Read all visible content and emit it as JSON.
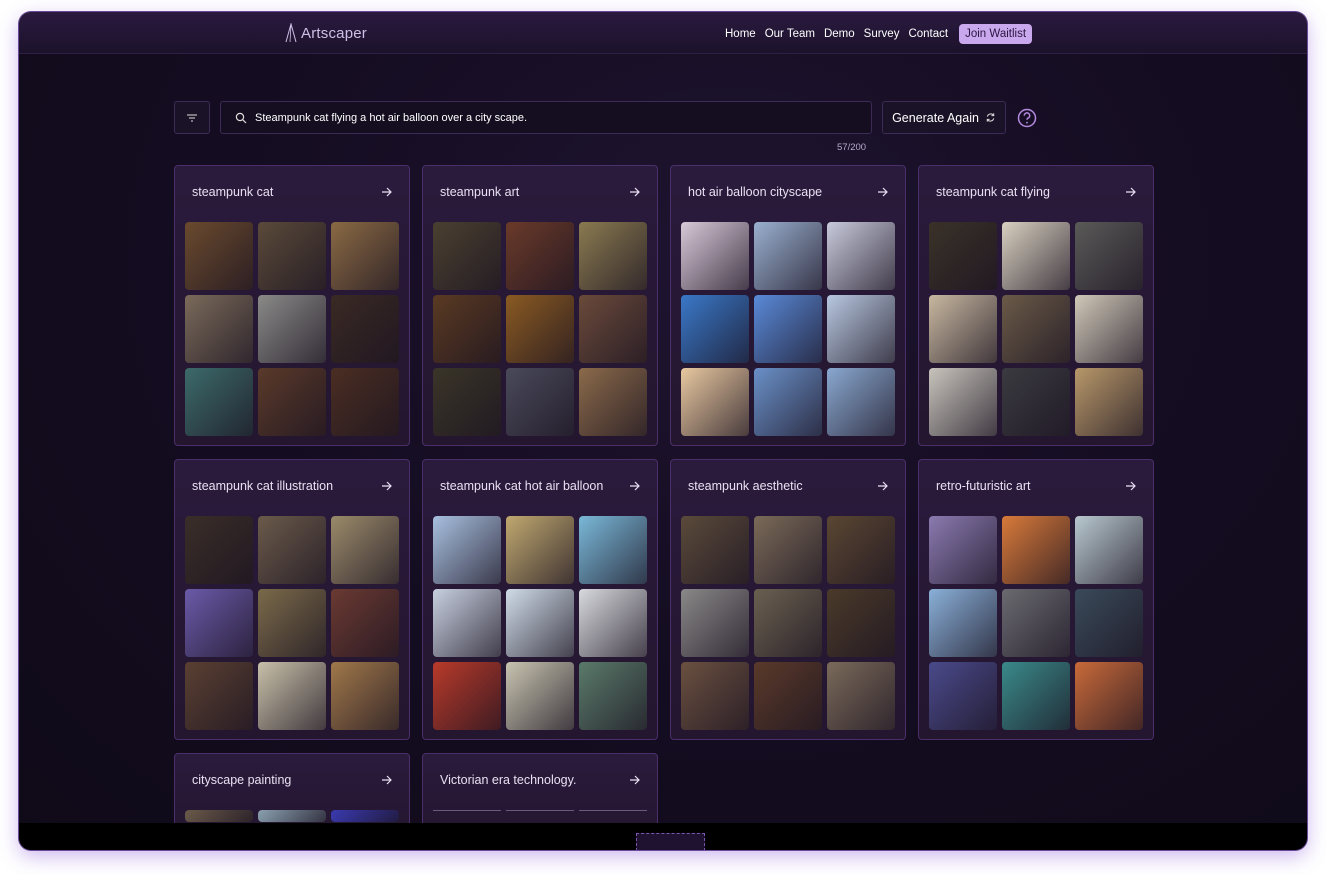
{
  "app": {
    "logo_text": "Artscaper",
    "nav": [
      "Home",
      "Our Team",
      "Demo",
      "Survey",
      "Contact"
    ],
    "cta": "Join Waitlist"
  },
  "search": {
    "query": "Steampunk cat flying a hot air balloon over a city scape.",
    "counter": "57/200",
    "generate_label": "Generate Again"
  },
  "colors": {
    "accent": "#c9a8ee",
    "background": "#150d22",
    "card": "#27182f",
    "card_border": "#4a2f6a"
  },
  "cards": [
    {
      "title": "steampunk cat",
      "thumbs": [
        "#6a4a2e",
        "#5a4a3a",
        "#8a6a44",
        "#7a6a5a",
        "#8a8a88",
        "#3a2a24",
        "#3c6a6a",
        "#5a3a2a",
        "#4a2e22"
      ]
    },
    {
      "title": "steampunk art",
      "thumbs": [
        "#4a4030",
        "#6a3a2a",
        "#8a7a50",
        "#5a3a22",
        "#8a5a22",
        "#6a4a3a",
        "#3a3528",
        "#4a4a5a",
        "#8a6a4a"
      ]
    },
    {
      "title": "hot air balloon cityscape",
      "thumbs": [
        "#d8c8d8",
        "#9ab0d0",
        "#c8cadc",
        "#3a78c8",
        "#5a8ad8",
        "#b8c8e0",
        "#e8c8a0",
        "#6a90c8",
        "#8aa8d0"
      ]
    },
    {
      "title": "steampunk cat flying",
      "thumbs": [
        "#3a3228",
        "#d8d0c0",
        "#5a5a58",
        "#c8b8a0",
        "#6a5a48",
        "#d0c8b8",
        "#c8c4bc",
        "#3a3a40",
        "#b8986a"
      ]
    },
    {
      "title": "steampunk cat illustration",
      "thumbs": [
        "#3a2e28",
        "#6a5a4a",
        "#9a8a6a",
        "#6a5aa8",
        "#7a6a4a",
        "#6a3a32",
        "#5a4032",
        "#c8c0a8",
        "#a0784a"
      ]
    },
    {
      "title": "steampunk cat hot air balloon",
      "thumbs": [
        "#a8c0e0",
        "#c0a870",
        "#7ab8d8",
        "#c8d0e0",
        "#d0dce8",
        "#d8dade",
        "#b83a2a",
        "#c8c4b0",
        "#5a7a6a"
      ]
    },
    {
      "title": "steampunk aesthetic",
      "thumbs": [
        "#5a4a3a",
        "#7a6a58",
        "#5a4632",
        "#8a8888",
        "#6a6050",
        "#4a3a2a",
        "#6a5040",
        "#5a3a2a",
        "#7a6a5a"
      ]
    },
    {
      "title": "retro-futuristic art",
      "thumbs": [
        "#8a7ab0",
        "#d87a3a",
        "#b8c8d0",
        "#8ab0d8",
        "#6a6a70",
        "#3a4a5a",
        "#4a4a8a",
        "#3a8a8a",
        "#c86a3a"
      ]
    },
    {
      "title": "cityscape painting",
      "thumbs": [
        "#6a5a4a",
        "#8aa0b0",
        "#3a3ab0"
      ]
    },
    {
      "title": "Victorian era technology.",
      "thumbs": [
        "broken",
        "broken",
        "broken"
      ]
    }
  ]
}
